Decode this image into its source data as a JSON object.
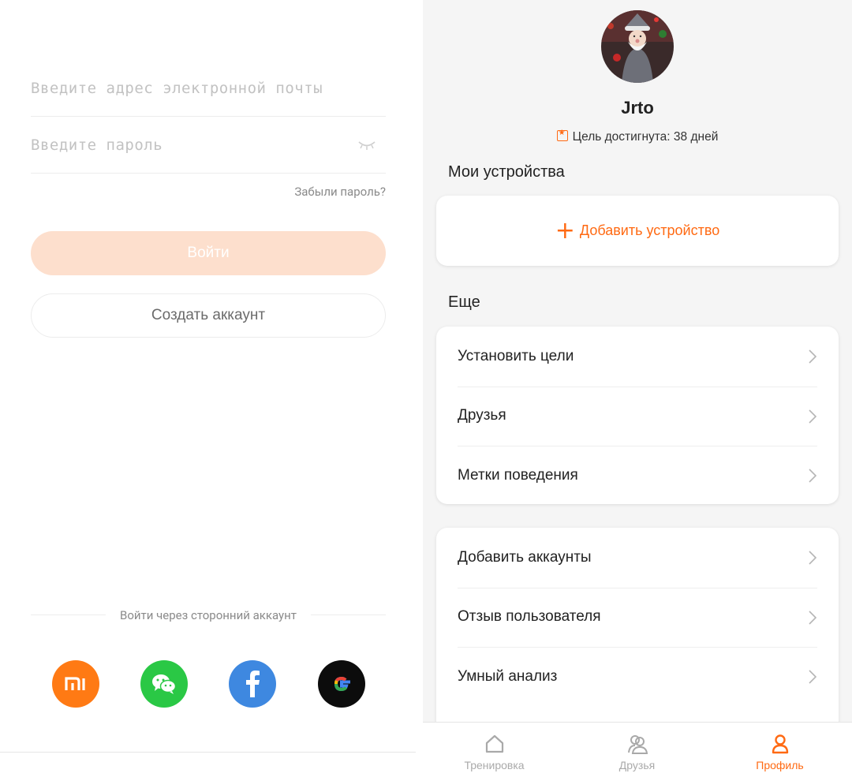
{
  "login": {
    "email_placeholder": "Введите адрес электронной почты",
    "password_placeholder": "Введите пароль",
    "forgot_password": "Забыли пароль?",
    "login_button": "Войти",
    "create_account_button": "Создать аккаунт",
    "third_party_label": "Войти через сторонний аккаунт",
    "social_providers": [
      "mi-icon",
      "wechat-icon",
      "facebook-icon",
      "google-icon"
    ],
    "colors": {
      "login_button_bg": "#fddfcd",
      "mi": "#ff7a14",
      "wechat": "#2ac845",
      "facebook": "#3e88e0",
      "google": "#0c0c0c"
    }
  },
  "profile": {
    "username": "Jrto",
    "goal_text": "Цель достигнута: 38 дней",
    "devices_title": "Мои устройства",
    "add_device_label": "Добавить устройство",
    "more_title": "Еще",
    "menu_group_1": [
      {
        "label": "Установить цели"
      },
      {
        "label": "Друзья"
      },
      {
        "label": "Метки поведения"
      }
    ],
    "menu_group_2": [
      {
        "label": "Добавить аккаунты"
      },
      {
        "label": "Отзыв пользователя"
      },
      {
        "label": "Умный анализ"
      }
    ],
    "accent_color": "#ff6a13"
  },
  "bottom_nav": {
    "items": [
      {
        "label": "Тренировка",
        "icon": "home-icon",
        "active": false
      },
      {
        "label": "Друзья",
        "icon": "friends-icon",
        "active": false
      },
      {
        "label": "Профиль",
        "icon": "person-icon",
        "active": true
      }
    ]
  }
}
